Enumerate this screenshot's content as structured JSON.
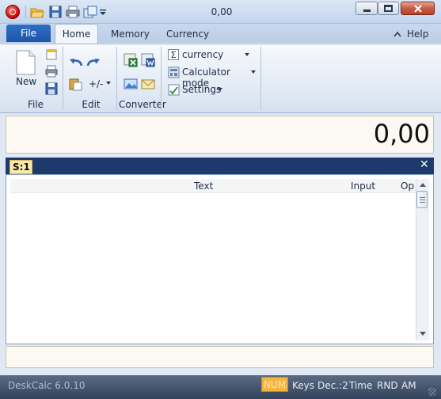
{
  "window": {
    "title": "0,00"
  },
  "quick_access": [
    "open-icon",
    "save-icon",
    "print-icon",
    "copy-icon",
    "dropdown-icon"
  ],
  "tabs": {
    "file": "File",
    "home": "Home",
    "memory": "Memory",
    "currency": "Currency",
    "help": "Help"
  },
  "ribbon": {
    "file_group": {
      "label": "File",
      "new_label": "New"
    },
    "edit_group": {
      "label": "Edit",
      "sign_label": "+/-"
    },
    "converter_group": {
      "label": "Converter"
    },
    "settings_group": {
      "currency_label": "currency",
      "calculator_mode_label": "Calculator mode",
      "settings_label": "Settings"
    }
  },
  "display": {
    "value": "0,00"
  },
  "document": {
    "tab_label": "S:1",
    "columns": {
      "text": "Text",
      "input": "Input",
      "op": "Op"
    }
  },
  "status": {
    "version": "DeskCalc 6.0.10",
    "num": "NUM",
    "keys": "Keys",
    "decimals": "Dec.:2",
    "time": "Time",
    "rnd": "RND",
    "am": "AM"
  },
  "colors": {
    "accent": "#1d56a8",
    "status_bg": "#34435c",
    "num_highlight": "#f5b43c",
    "doc_bar": "#1c3a6b"
  }
}
